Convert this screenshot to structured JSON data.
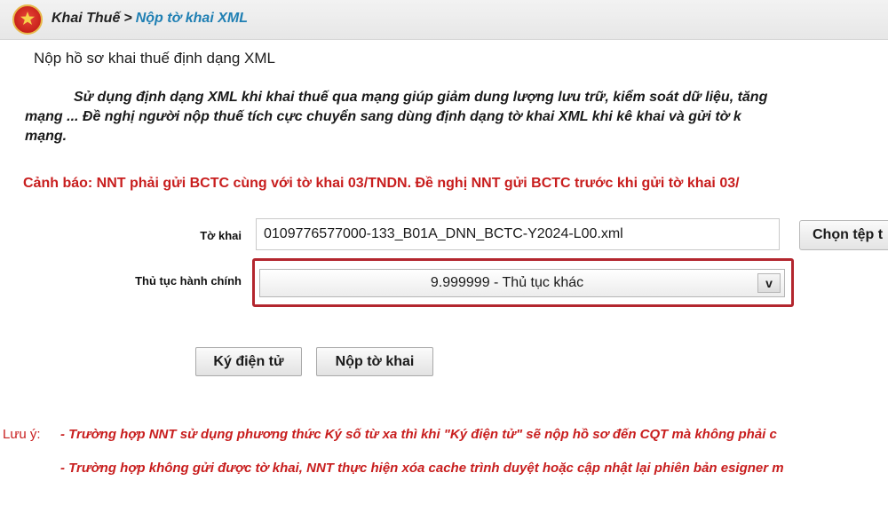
{
  "header": {
    "breadcrumb_root": "Khai Thuế",
    "breadcrumb_separator": ">",
    "breadcrumb_current": "Nộp tờ khai XML"
  },
  "page_title": "Nộp hồ sơ khai thuế định dạng XML",
  "intro": {
    "line1": "Sử dụng định dạng XML khi khai thuế qua mạng giúp giảm dung lượng lưu trữ, kiểm soát dữ liệu, tăng",
    "line2": "mạng ... Đề nghị người nộp thuế tích cực chuyển sang dùng định dạng tờ khai XML khi kê khai và gửi tờ k",
    "line3": "mạng."
  },
  "warning": "Cảnh báo: NNT phải gửi BCTC cùng với tờ khai 03/TNDN. Đề nghị NNT gửi BCTC trước khi gửi tờ khai 03/",
  "form": {
    "tokhai_label": "Tờ khai",
    "tokhai_value": "0109776577000-133_B01A_DNN_BCTC-Y2024-L00.xml",
    "choose_file_label": "Chọn tệp t",
    "thutuc_label": "Thủ tục hành chính",
    "thutuc_selected": "9.999999 - Thủ tục khác",
    "dropdown_arrow": "v"
  },
  "buttons": {
    "sign": "Ký điện tử",
    "submit": "Nộp tờ khai"
  },
  "notes": {
    "label": "Lưu ý:",
    "item1": "- Trường hợp NNT sử dụng phương thức Ký số từ xa thì khi \"Ký điện tử\" sẽ nộp hồ sơ đến CQT mà không phải c",
    "item2": "- Trường hợp không gửi được tờ khai, NNT thực hiện xóa cache trình duyệt hoặc cập nhật lại phiên bản esigner m"
  },
  "colors": {
    "warning_red": "#c81e1e",
    "breadcrumb_link": "#1f7fb3",
    "highlight_border": "#b3262e"
  },
  "icons": {
    "emblem": "national-emblem-icon"
  }
}
